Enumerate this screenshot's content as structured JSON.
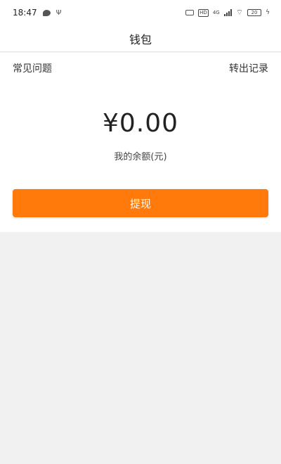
{
  "status_bar": {
    "time": "18:47",
    "hd": "HD",
    "network": "4G",
    "battery": "20"
  },
  "header": {
    "title": "钱包"
  },
  "wallet": {
    "faq_link": "常见问题",
    "records_link": "转出记录",
    "balance": "¥0.00",
    "balance_label": "我的余额(元)",
    "withdraw_label": "提现",
    "accent_color": "#ff7a0a"
  }
}
